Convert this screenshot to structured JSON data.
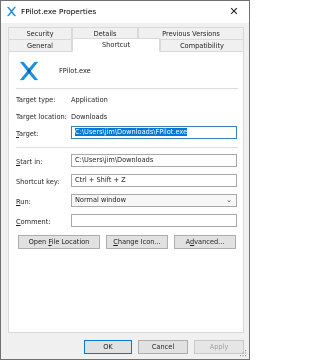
{
  "window": {
    "title": "FPilot.exe Properties",
    "close_label": "✕"
  },
  "tabs": [
    {
      "label": "Security"
    },
    {
      "label": "Details"
    },
    {
      "label": "Previous Versions"
    },
    {
      "label": "General"
    },
    {
      "label": "Shortcut"
    },
    {
      "label": "Compatibility"
    }
  ],
  "header": {
    "app_name": "FPilot.exe"
  },
  "info": {
    "target_type_label": "Target type:",
    "target_type_value": "Application",
    "target_location_label": "Target location:",
    "target_location_value": "Downloads"
  },
  "target": {
    "label_pre": "",
    "label_key": "T",
    "label_post": "arget:",
    "value": "C:\\Users\\jim\\Downloads\\FPilot.exe"
  },
  "start_in": {
    "label_pre": "",
    "label_key": "S",
    "label_post": "tart in:",
    "value": "C:\\Users\\jim\\Downloads"
  },
  "shortcut_key": {
    "label": "Shortcut key:",
    "value": "Ctrl + Shift + Z"
  },
  "run": {
    "label_pre": "",
    "label_key": "R",
    "label_post": "un:",
    "value": "Normal window"
  },
  "comment": {
    "label_pre": "",
    "label_key": "C",
    "label_post": "omment:",
    "value": ""
  },
  "actions": {
    "open_location_pre": "Open ",
    "open_location_key": "F",
    "open_location_post": "ile Location",
    "change_icon_pre": "",
    "change_icon_key": "C",
    "change_icon_post": "hange Icon...",
    "advanced_pre": "A",
    "advanced_key": "d",
    "advanced_post": "vanced..."
  },
  "footer": {
    "ok": "OK",
    "cancel": "Cancel",
    "apply": "Apply"
  },
  "colors": {
    "accent": "#0078d7",
    "app_icon": "#1e8fe0"
  }
}
